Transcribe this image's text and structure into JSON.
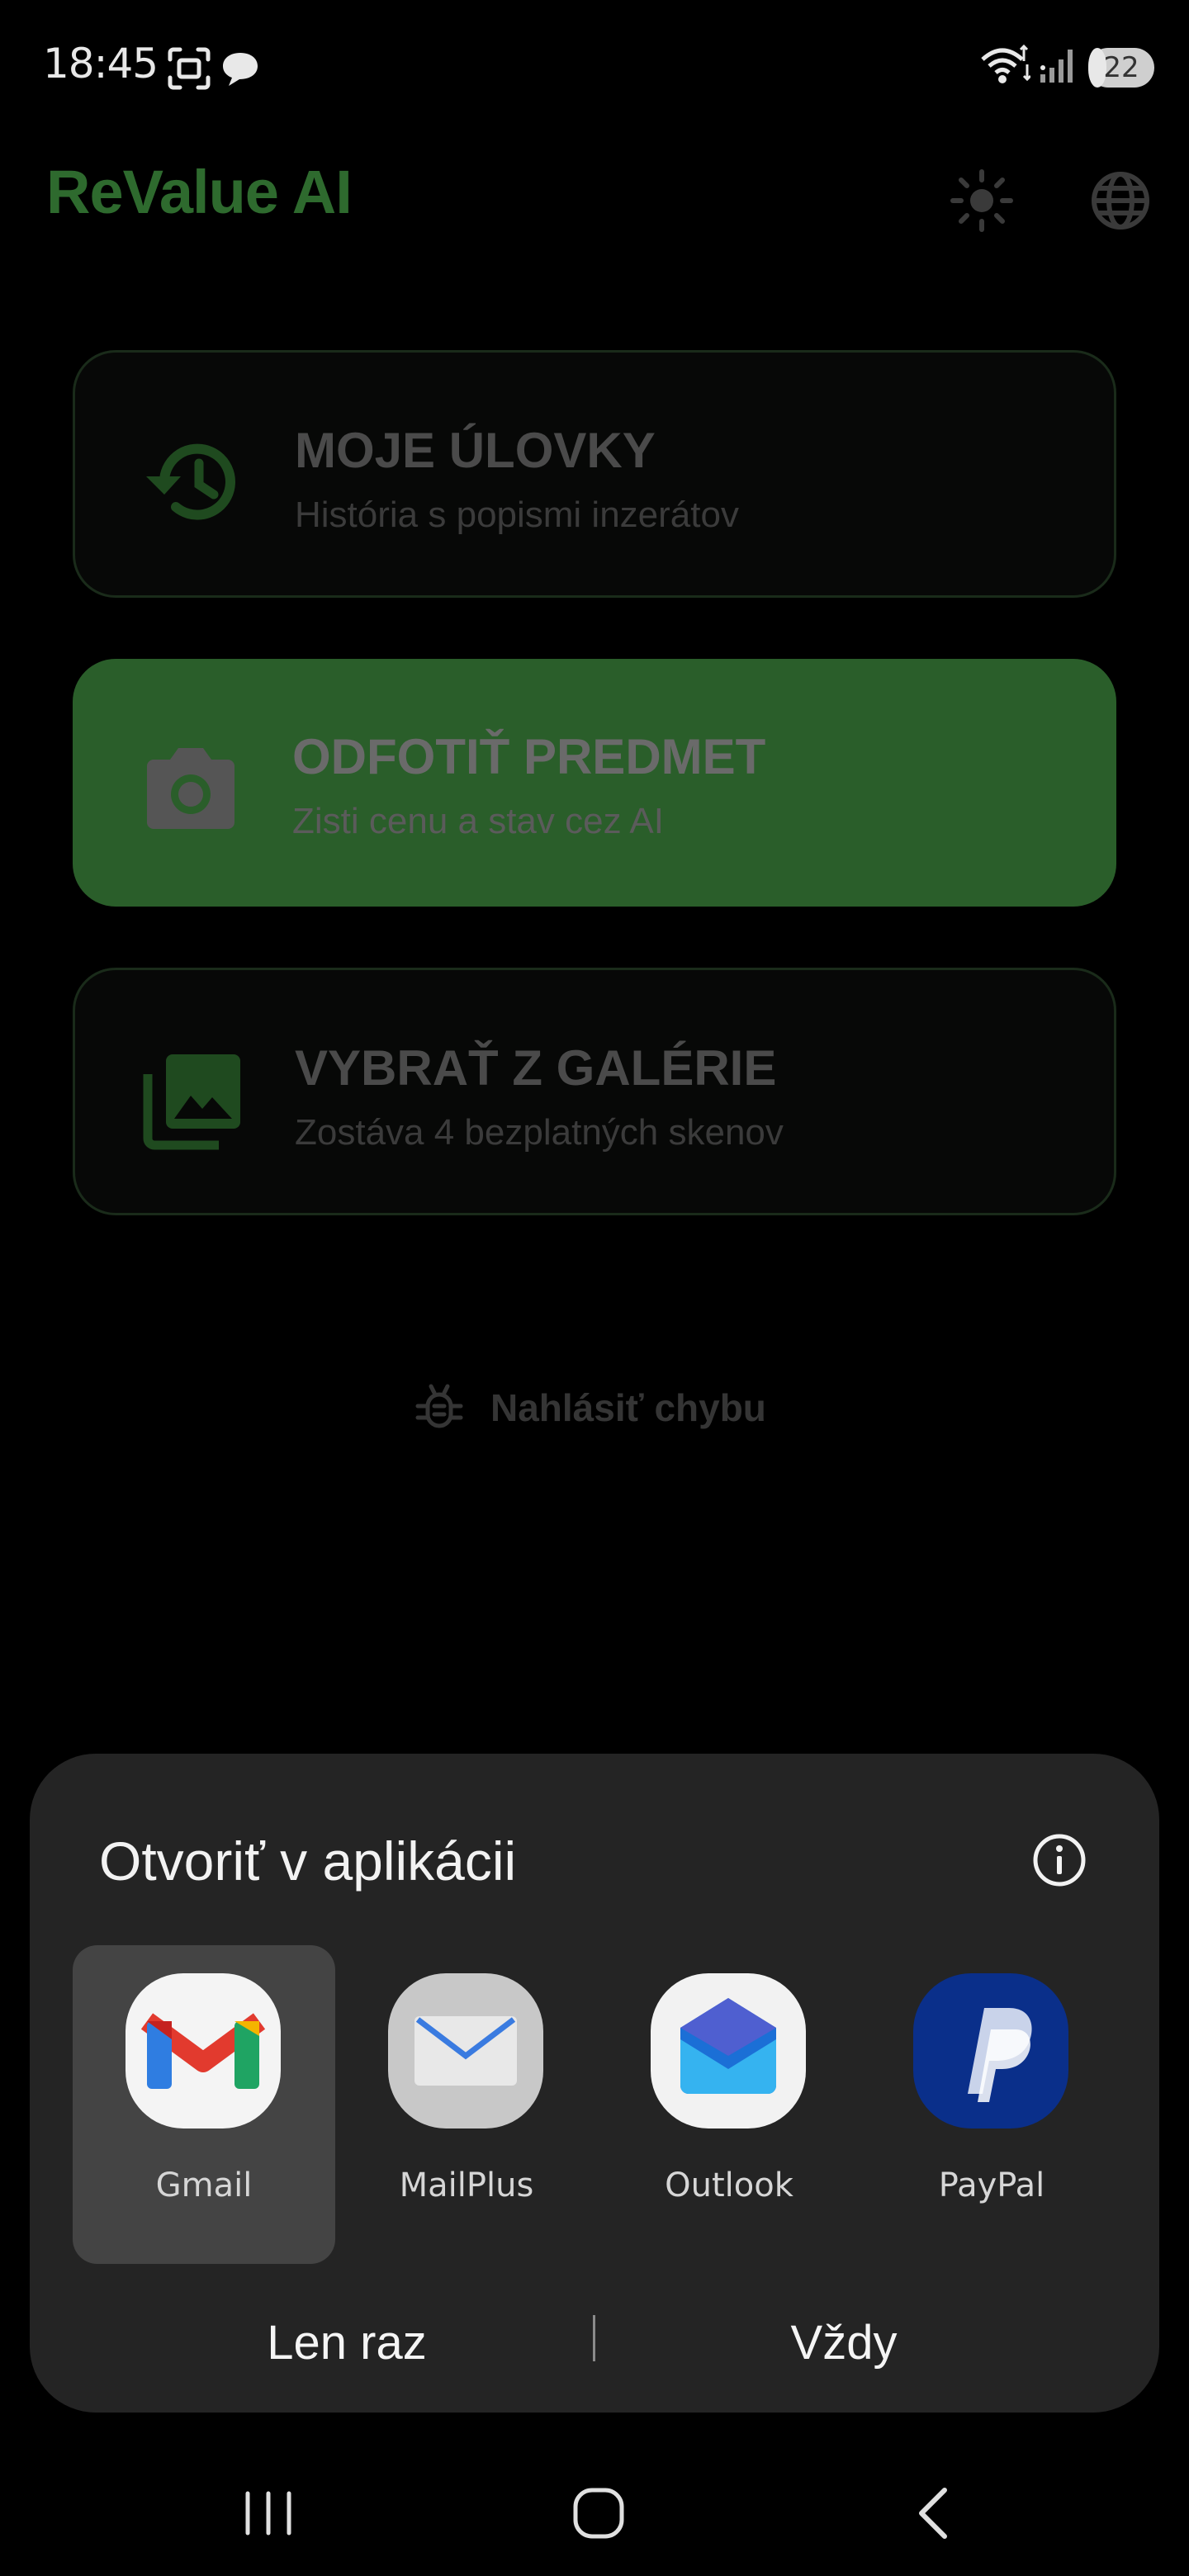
{
  "status_bar": {
    "time": "18:45",
    "battery_level": "22",
    "icons": [
      "screenshot-icon",
      "chat-icon",
      "wifi-icon",
      "signal-icon",
      "battery-icon"
    ]
  },
  "header": {
    "title": "ReValue AI",
    "title_color": "#2e6a2e",
    "theme_icon": "sun-icon",
    "language_icon": "globe-icon"
  },
  "cards": [
    {
      "title": "MOJE ÚLOVKY",
      "subtitle": "História s popismi inzerátov",
      "icon": "history-icon"
    },
    {
      "title": "ODFOTIŤ PREDMET",
      "subtitle": "Zisti cenu a stav cez AI",
      "icon": "camera-icon",
      "accent": "#2a5e2a"
    },
    {
      "title": "VYBRAŤ Z GALÉRIE",
      "subtitle": "Zostáva 4 bezplatných skenov",
      "icon": "gallery-icon"
    }
  ],
  "report_bug": {
    "label": "Nahlásiť chybu",
    "icon": "bug-icon"
  },
  "sheet": {
    "title": "Otvoriť v aplikácii",
    "info_icon": "info-icon",
    "apps": [
      {
        "label": "Gmail",
        "icon": "gmail-icon",
        "selected": true
      },
      {
        "label": "MailPlus",
        "icon": "mailplus-icon",
        "selected": false
      },
      {
        "label": "Outlook",
        "icon": "outlook-icon",
        "selected": false
      },
      {
        "label": "PayPal",
        "icon": "paypal-icon",
        "selected": false
      }
    ],
    "once_label": "Len raz",
    "always_label": "Vždy"
  },
  "nav_bar": {
    "icons": [
      "recents-icon",
      "home-icon",
      "back-icon"
    ]
  }
}
